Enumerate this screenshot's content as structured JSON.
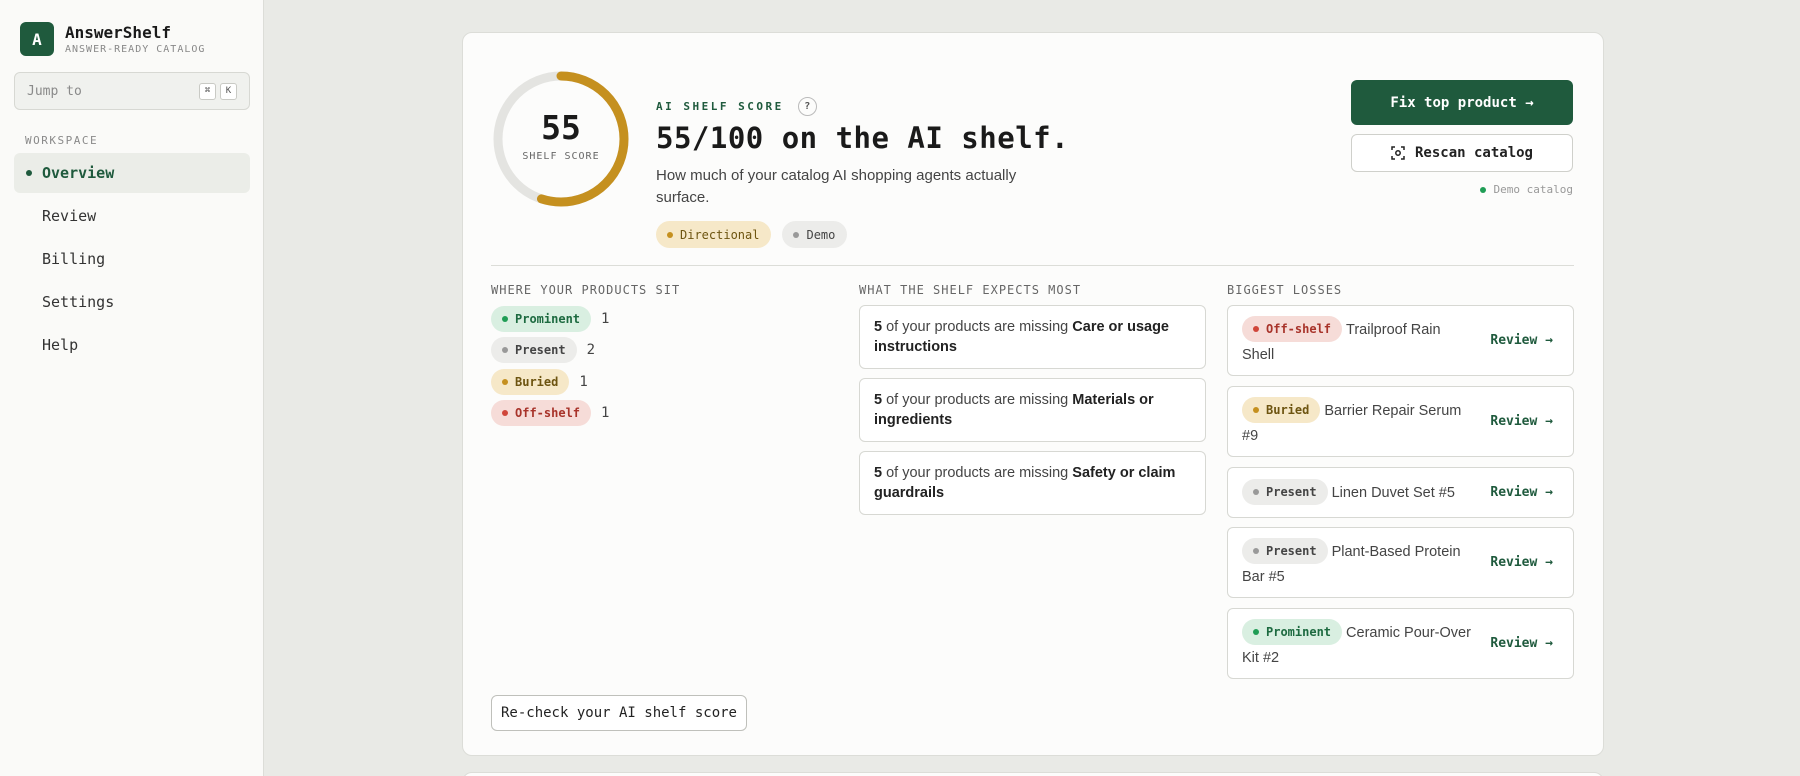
{
  "brand": {
    "initial": "A",
    "name": "AnswerShelf",
    "tagline": "ANSWER-READY CATALOG"
  },
  "search": {
    "placeholder": "Jump to",
    "shortcut_mod": "⌘",
    "shortcut_key": "K"
  },
  "sidebar": {
    "section_label": "WORKSPACE",
    "items": [
      {
        "label": "Overview",
        "active": true
      },
      {
        "label": "Review"
      },
      {
        "label": "Billing"
      },
      {
        "label": "Settings"
      },
      {
        "label": "Help"
      }
    ]
  },
  "score": {
    "value": "55",
    "max": 100,
    "ring_label": "SHELF SCORE",
    "eyebrow": "AI SHELF SCORE",
    "help_icon": "?",
    "headline": "55/100 on the AI shelf.",
    "subtext": "How much of your catalog AI shopping agents actually surface.",
    "badges": [
      "Directional",
      "Demo"
    ]
  },
  "actions": {
    "primary": "Fix top product →",
    "secondary": "Rescan catalog",
    "note": "Demo catalog"
  },
  "placement": {
    "title": "WHERE YOUR PRODUCTS SIT",
    "rows": [
      {
        "label": "Prominent",
        "count": "1"
      },
      {
        "label": "Present",
        "count": "2"
      },
      {
        "label": "Buried",
        "count": "1"
      },
      {
        "label": "Off-shelf",
        "count": "1"
      }
    ]
  },
  "expectations": {
    "title": "WHAT THE SHELF EXPECTS MOST",
    "items": [
      {
        "count": "5",
        "text": " of your products are missing ",
        "field": "Care or usage instructions"
      },
      {
        "count": "5",
        "text": " of your products are missing ",
        "field": "Materials or ingredients"
      },
      {
        "count": "5",
        "text": " of your products are missing ",
        "field": "Safety or claim guardrails"
      }
    ]
  },
  "losses": {
    "title": "BIGGEST LOSSES",
    "review_label": "Review →",
    "items": [
      {
        "status": "Off-shelf",
        "product": "Trailproof Rain Shell"
      },
      {
        "status": "Buried",
        "product": "Barrier Repair Serum #9"
      },
      {
        "status": "Present",
        "product": "Linen Duvet Set #5"
      },
      {
        "status": "Present",
        "product": "Plant-Based Protein Bar #5"
      },
      {
        "status": "Prominent",
        "product": "Ceramic Pour-Over Kit #2"
      }
    ]
  },
  "recheck_label": "Re-check your AI shelf score",
  "colors": {
    "brand": "#1f5a3d",
    "ring_fill": "#c5901f",
    "ring_track": "#e4e4e1",
    "prominent": "#1f9d55",
    "buried": "#c5901f",
    "offshelf": "#d0463a",
    "present": "#999999"
  }
}
